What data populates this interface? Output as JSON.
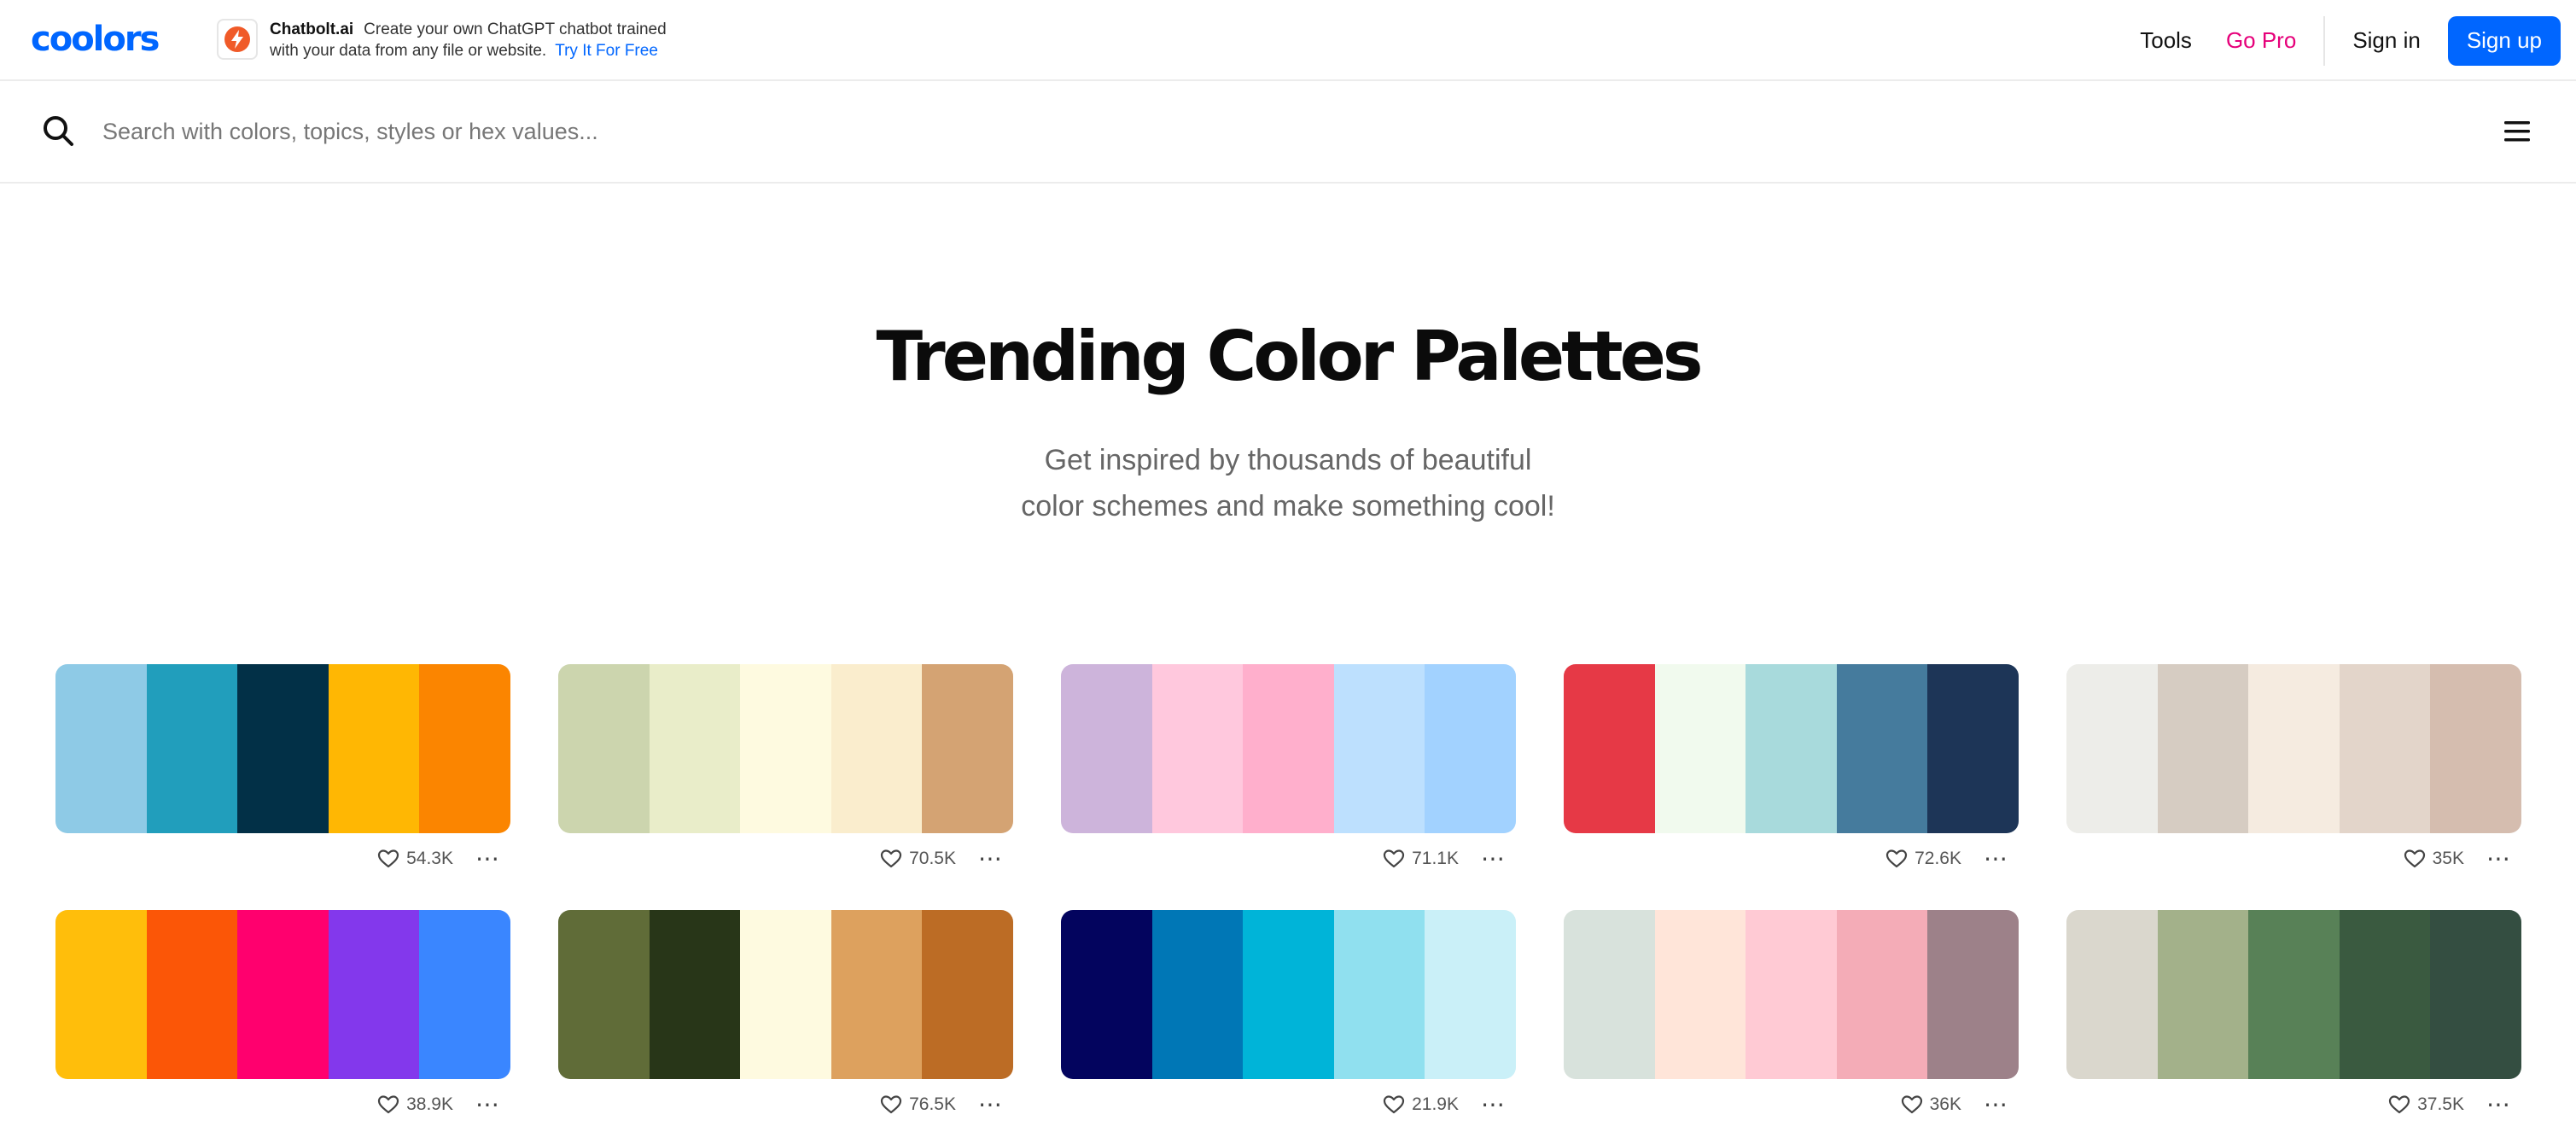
{
  "brand": {
    "logo": "coolors"
  },
  "ad": {
    "brand": "Chatbolt.ai",
    "line1": "Create your own ChatGPT chatbot trained",
    "line2": "with your data from any file or website.",
    "cta": "Try It For Free"
  },
  "nav": {
    "tools": "Tools",
    "gopro": "Go Pro",
    "signin": "Sign in",
    "signup": "Sign up"
  },
  "search": {
    "placeholder": "Search with colors, topics, styles or hex values..."
  },
  "hero": {
    "title": "Trending Color Palettes",
    "subtitle_line1": "Get inspired by thousands of beautiful",
    "subtitle_line2": "color schemes and make something cool!"
  },
  "icons": {
    "search": "search-icon",
    "menu": "hamburger-menu-icon",
    "heart": "heart-icon",
    "more": "more-dots-icon",
    "ad": "chatbolt-logo-icon"
  },
  "colors": {
    "accent": "#0066ff",
    "gopro": "#e6007a"
  },
  "palettes": [
    {
      "colors": [
        "#8ecae6",
        "#219ebc",
        "#023047",
        "#ffb703",
        "#fb8500"
      ],
      "likes": "54.3K"
    },
    {
      "colors": [
        "#ccd5ae",
        "#e9edc9",
        "#fefae0",
        "#faedcd",
        "#d4a373"
      ],
      "likes": "70.5K"
    },
    {
      "colors": [
        "#cdb4db",
        "#ffc8dd",
        "#ffafcc",
        "#bde0fe",
        "#a2d2ff"
      ],
      "likes": "71.1K"
    },
    {
      "colors": [
        "#e63946",
        "#f1faee",
        "#a8dadc",
        "#457b9d",
        "#1d3557"
      ],
      "likes": "72.6K"
    },
    {
      "colors": [
        "#edede9",
        "#d6ccc2",
        "#f5ebe0",
        "#e3d5ca",
        "#d5bdaf"
      ],
      "likes": "35K"
    },
    {
      "colors": [
        "#ffbe0b",
        "#fb5607",
        "#ff006e",
        "#8338ec",
        "#3a86ff"
      ],
      "likes": "38.9K"
    },
    {
      "colors": [
        "#606c38",
        "#283618",
        "#fefae0",
        "#dda15e",
        "#bc6c25"
      ],
      "likes": "76.5K"
    },
    {
      "colors": [
        "#03045e",
        "#0077b6",
        "#00b4d8",
        "#90e0ef",
        "#caf0f8"
      ],
      "likes": "21.9K"
    },
    {
      "colors": [
        "#d8e2dc",
        "#ffe5d9",
        "#ffcad4",
        "#f4acb7",
        "#9d8189"
      ],
      "likes": "36K"
    },
    {
      "colors": [
        "#dad7cd",
        "#a3b18a",
        "#588157",
        "#3a5a40",
        "#344e41"
      ],
      "likes": "37.5K"
    }
  ]
}
